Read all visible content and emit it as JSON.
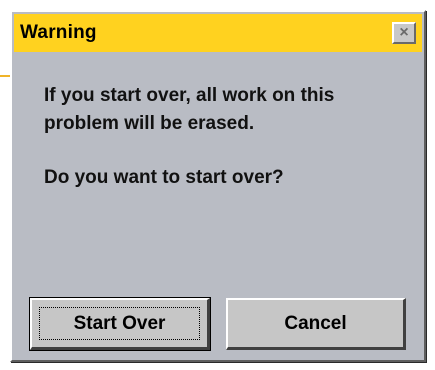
{
  "dialog": {
    "title": "Warning",
    "close_glyph": "×",
    "message_line_1": "If you start over, all work on this problem will be erased.",
    "message_line_2": "Do you want to start over?",
    "buttons": {
      "start_over_label": "Start Over",
      "cancel_label": "Cancel"
    }
  },
  "colors": {
    "titlebar": "#ffd21f",
    "dialog_body": "#b9bcc4",
    "button_face": "#c6c6c6",
    "pointer_line": "#f0b429"
  },
  "icons": {
    "close": "close-icon"
  }
}
